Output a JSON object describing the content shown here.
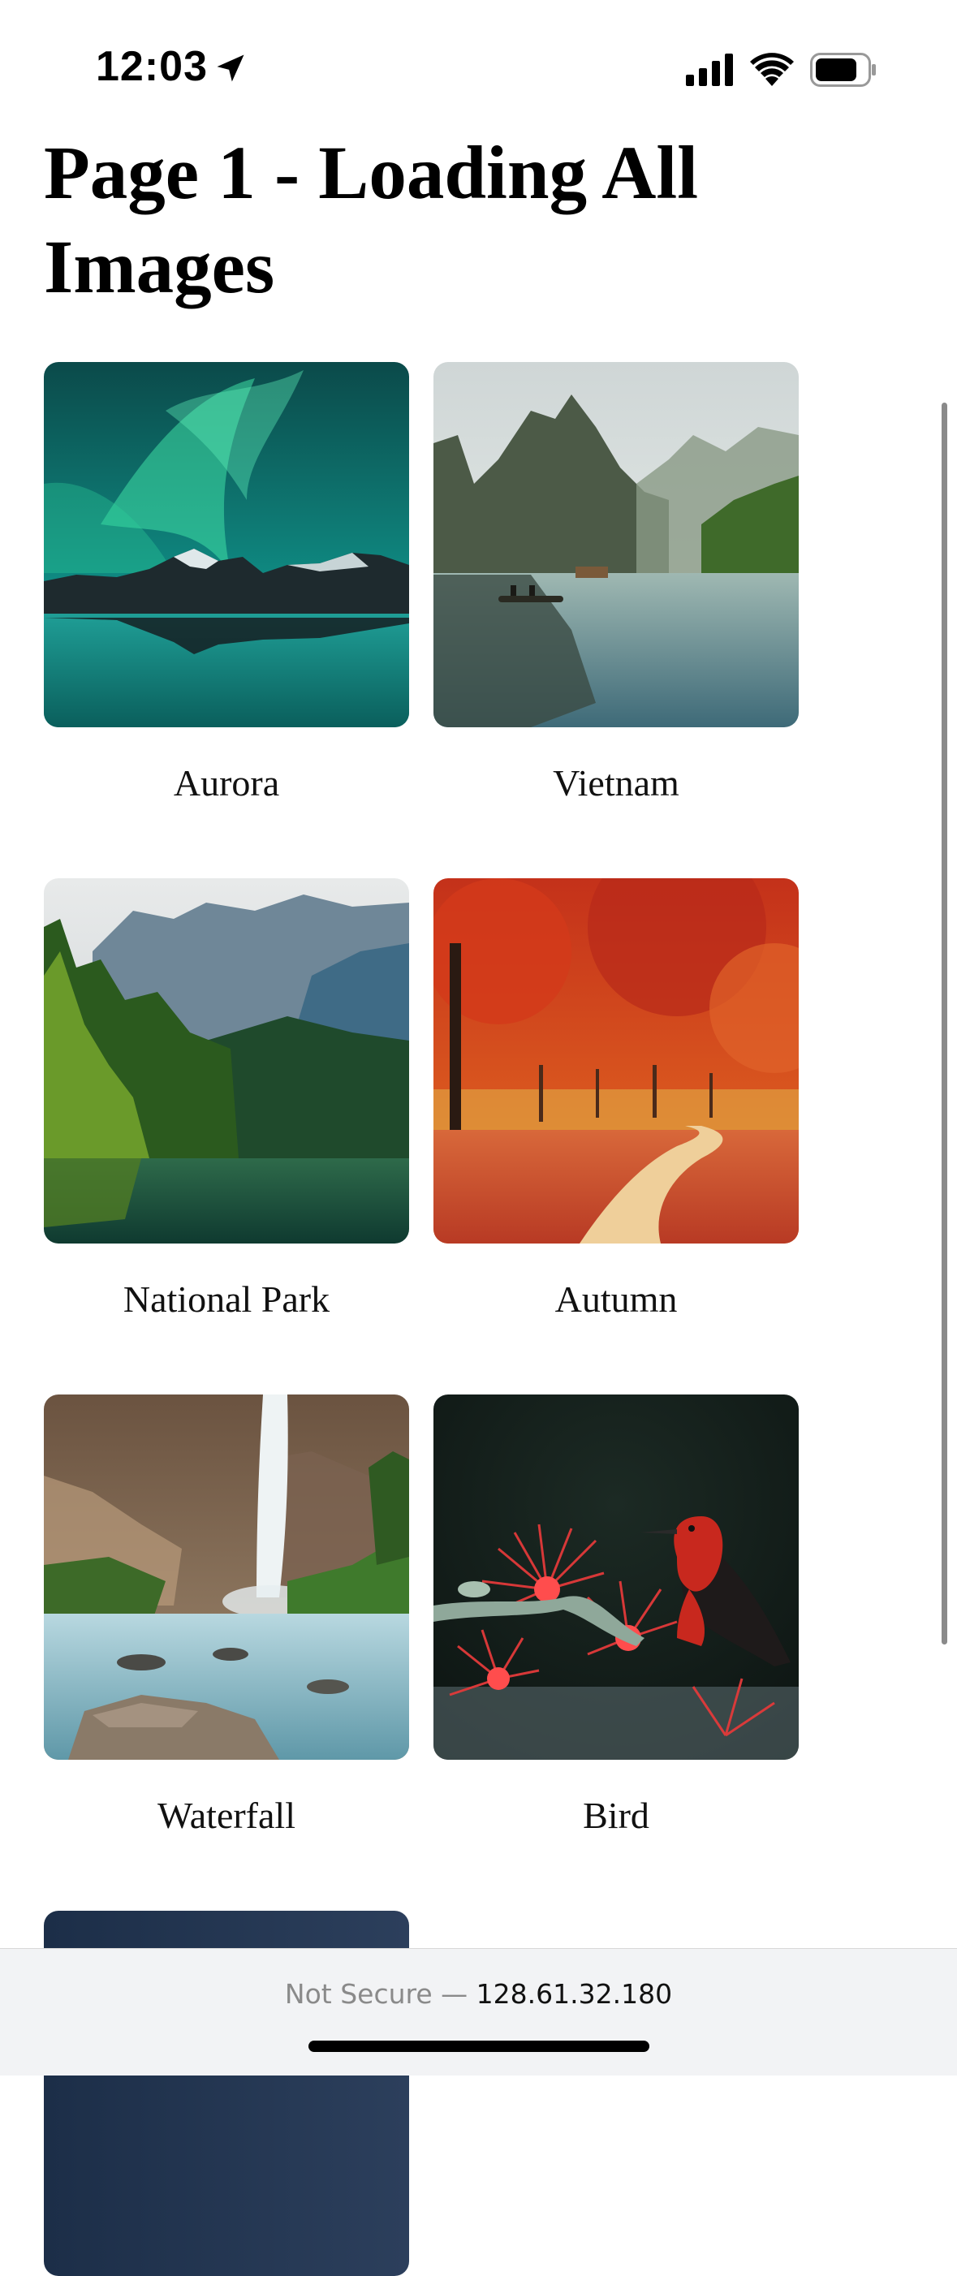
{
  "status_bar": {
    "time": "12:03",
    "icons": [
      "location-arrow-icon",
      "cellular-signal-icon",
      "wifi-icon",
      "battery-icon"
    ]
  },
  "page": {
    "title": "Page 1 - Loading All Images"
  },
  "gallery": {
    "items": [
      {
        "label": "Aurora",
        "image": "aurora over mountain lake"
      },
      {
        "label": "Vietnam",
        "image": "karst mountains with boat on lake"
      },
      {
        "label": "National Park",
        "image": "forest mountain lake"
      },
      {
        "label": "Autumn",
        "image": "red autumn trees and path"
      },
      {
        "label": "Waterfall",
        "image": "waterfall over rocks"
      },
      {
        "label": "Bird",
        "image": "red bird on red flowers"
      },
      {
        "label": "",
        "image": "partially visible dark image"
      }
    ]
  },
  "browser": {
    "security_label": "Not Secure —",
    "host": "128.61.32.180"
  },
  "colors": {
    "background": "#ffffff",
    "toolbar": "#f2f3f5",
    "text": "#000000"
  }
}
